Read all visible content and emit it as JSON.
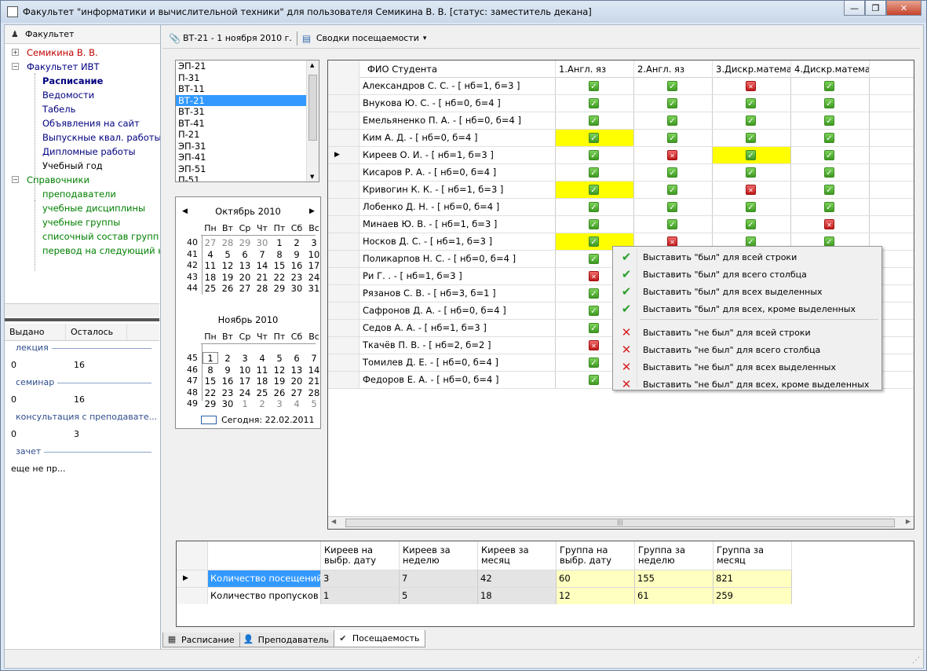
{
  "window": {
    "title": "Факультет \"информатики и вычислительной техники\" для пользователя Семикина В. В. [статус: заместитель декана]",
    "min": "—",
    "max": "❐",
    "close": "✕"
  },
  "left_panel": {
    "header": "Факультет",
    "tree": [
      {
        "label": "Семикина В. В.",
        "level": 0,
        "color": "red",
        "expander": "+"
      },
      {
        "label": "Факультет ИВТ",
        "level": 0,
        "color": "navy",
        "expander": "−"
      },
      {
        "label": "Расписание",
        "level": 1,
        "color": "navy",
        "bold": true
      },
      {
        "label": "Ведомости",
        "level": 1,
        "color": "navy"
      },
      {
        "label": "Табель",
        "level": 1,
        "color": "navy"
      },
      {
        "label": "Объявления на сайт",
        "level": 1,
        "color": "navy"
      },
      {
        "label": "Выпускные квал. работы",
        "level": 1,
        "color": "navy"
      },
      {
        "label": "Дипломные работы",
        "level": 1,
        "color": "navy"
      },
      {
        "label": "Учебный год",
        "level": 1,
        "color": "black"
      },
      {
        "label": "Справочники",
        "level": 0,
        "color": "green",
        "expander": "−"
      },
      {
        "label": "преподаватели",
        "level": 1,
        "color": "green"
      },
      {
        "label": "учебные дисциплины",
        "level": 1,
        "color": "green"
      },
      {
        "label": "учебные группы",
        "level": 1,
        "color": "green"
      },
      {
        "label": "списочный состав групп",
        "level": 1,
        "color": "green"
      },
      {
        "label": "перевод на следующий к",
        "level": 1,
        "color": "green"
      }
    ],
    "stats_header": [
      "Выдано",
      "Осталось"
    ],
    "stats": [
      {
        "group": "лекция",
        "issued": "0",
        "left": "16"
      },
      {
        "group": "семинар",
        "issued": "0",
        "left": "16"
      },
      {
        "group": "консультация с преподавате...",
        "issued": "0",
        "left": "3"
      },
      {
        "group": "зачет",
        "issued": "еще не пр...",
        "left": ""
      }
    ]
  },
  "toolbar": {
    "group_date": "ВТ-21 - 1 ноября 2010 г.",
    "reports": "Сводки посещаемости",
    "reports_arrow": "▾"
  },
  "groups_list": {
    "items": [
      "ЭП-21",
      "П-31",
      "ВТ-11",
      "ВТ-21",
      "ВТ-31",
      "ВТ-41",
      "П-21",
      "ЭП-31",
      "ЭП-41",
      "ЭП-51",
      "П-51"
    ],
    "selected": "ВТ-21"
  },
  "calendar": {
    "prev": "◀",
    "next": "▶",
    "weekdays": [
      "Пн",
      "Вт",
      "Ср",
      "Чт",
      "Пт",
      "Сб",
      "Вс"
    ],
    "months": [
      {
        "title": "Октябрь 2010",
        "weeks": [
          {
            "n": "40",
            "days": [
              "27",
              "28",
              "29",
              "30",
              "1",
              "2",
              "3"
            ],
            "gray_count": 4
          },
          {
            "n": "41",
            "days": [
              "4",
              "5",
              "6",
              "7",
              "8",
              "9",
              "10"
            ]
          },
          {
            "n": "42",
            "days": [
              "11",
              "12",
              "13",
              "14",
              "15",
              "16",
              "17"
            ]
          },
          {
            "n": "43",
            "days": [
              "18",
              "19",
              "20",
              "21",
              "22",
              "23",
              "24"
            ]
          },
          {
            "n": "44",
            "days": [
              "25",
              "26",
              "27",
              "28",
              "29",
              "30",
              "31"
            ]
          }
        ]
      },
      {
        "title": "Ноябрь 2010",
        "weeks": [
          {
            "n": "45",
            "days": [
              "1",
              "2",
              "3",
              "4",
              "5",
              "6",
              "7"
            ],
            "selected_index": 0
          },
          {
            "n": "46",
            "days": [
              "8",
              "9",
              "10",
              "11",
              "12",
              "13",
              "14"
            ]
          },
          {
            "n": "47",
            "days": [
              "15",
              "16",
              "17",
              "18",
              "19",
              "20",
              "21"
            ]
          },
          {
            "n": "48",
            "days": [
              "22",
              "23",
              "24",
              "25",
              "26",
              "27",
              "28"
            ]
          },
          {
            "n": "49",
            "days": [
              "29",
              "30",
              "1",
              "2",
              "3",
              "4",
              "5"
            ],
            "gray_from": 2
          }
        ]
      }
    ],
    "today": "Сегодня: 22.02.2011"
  },
  "attendance": {
    "columns": [
      "ФИО Студента",
      "1.Англ. яз",
      "2.Англ. яз",
      "3.Дискр.матема",
      "4.Дискр.матема"
    ],
    "current_row": 4,
    "rows": [
      {
        "name": "Александров С. С. - [ нб=1, б=3 ]",
        "marks": [
          "g",
          "g",
          "r",
          "g"
        ],
        "yellow": []
      },
      {
        "name": "Внукова Ю. С. - [ нб=0, б=4 ]",
        "marks": [
          "g",
          "g",
          "g",
          "g"
        ],
        "yellow": []
      },
      {
        "name": "Емельяненко П. А. - [ нб=0, б=4 ]",
        "marks": [
          "g",
          "g",
          "g",
          "g"
        ],
        "yellow": []
      },
      {
        "name": "Ким А. Д. - [ нб=0, б=4 ]",
        "marks": [
          "g",
          "g",
          "g",
          "g"
        ],
        "yellow": [
          0
        ]
      },
      {
        "name": "Киреев О. И. - [ нб=1, б=3 ]",
        "marks": [
          "g",
          "r",
          "g",
          "g"
        ],
        "yellow": [
          2
        ]
      },
      {
        "name": "Кисаров Р. А. - [ нб=0, б=4 ]",
        "marks": [
          "g",
          "g",
          "g",
          "g"
        ],
        "yellow": []
      },
      {
        "name": "Кривогин К. К. - [ нб=1, б=3 ]",
        "marks": [
          "g",
          "g",
          "r",
          "g"
        ],
        "yellow": [
          0
        ]
      },
      {
        "name": "Лобенко Д. Н. - [ нб=0, б=4 ]",
        "marks": [
          "g",
          "g",
          "g",
          "g"
        ],
        "yellow": []
      },
      {
        "name": "Минаев Ю. В. - [ нб=1, б=3 ]",
        "marks": [
          "g",
          "g",
          "g",
          "r"
        ],
        "yellow": []
      },
      {
        "name": "Носков Д. С. - [ нб=1, б=3 ]",
        "marks": [
          "g",
          "r",
          "g",
          "g"
        ],
        "yellow": [
          0
        ]
      },
      {
        "name": "Поликарпов Н. С. - [ нб=0, б=4 ]",
        "marks": [
          "g",
          "",
          "",
          ""
        ],
        "yellow": []
      },
      {
        "name": "Ри Г. . - [ нб=1, б=3 ]",
        "marks": [
          "r",
          "",
          "",
          ""
        ],
        "yellow": []
      },
      {
        "name": "Рязанов С. В. - [ нб=3, б=1 ]",
        "marks": [
          "g",
          "",
          "",
          ""
        ],
        "yellow": []
      },
      {
        "name": "Сафронов Д. А. - [ нб=0, б=4 ]",
        "marks": [
          "g",
          "",
          "",
          ""
        ],
        "yellow": []
      },
      {
        "name": "Седов А. А. - [ нб=1, б=3 ]",
        "marks": [
          "g",
          "",
          "",
          ""
        ],
        "yellow": []
      },
      {
        "name": "Ткачёв П. В. - [ нб=2, б=2 ]",
        "marks": [
          "r",
          "",
          "",
          ""
        ],
        "yellow": []
      },
      {
        "name": "Томилев Д. Е. - [ нб=0, б=4 ]",
        "marks": [
          "g",
          "",
          "",
          ""
        ],
        "yellow": []
      },
      {
        "name": "Федоров Е. А. - [ нб=0, б=4 ]",
        "marks": [
          "g",
          "",
          "",
          ""
        ],
        "yellow": []
      }
    ]
  },
  "context_menu": {
    "items": [
      {
        "icon": "check",
        "label": "Выставить \"был\" для всей строки"
      },
      {
        "icon": "check",
        "label": "Выставить \"был\" для всего столбца"
      },
      {
        "icon": "check",
        "label": "Выставить \"был\" для всех выделенных"
      },
      {
        "icon": "check",
        "label": "Выставить \"был\" для всех, кроме выделенных"
      },
      {
        "icon": "cross",
        "label": "Выставить \"не был\" для всей строки"
      },
      {
        "icon": "cross",
        "label": "Выставить \"не был\" для всего столбца"
      },
      {
        "icon": "cross",
        "label": "Выставить \"не был\" для всех выделенных"
      },
      {
        "icon": "cross",
        "label": "Выставить \"не был\" для всех, кроме выделенных"
      }
    ]
  },
  "summary": {
    "columns": [
      "Киреев на\nвыбр. дату",
      "Киреев за\nнеделю",
      "Киреев за\nмесяц",
      "Группа на\nвыбр. дату",
      "Группа за\nнеделю",
      "Группа за\nмесяц"
    ],
    "rows": [
      {
        "label": "Количество посещений",
        "values": [
          "3",
          "7",
          "42",
          "60",
          "155",
          "821"
        ]
      },
      {
        "label": "Количество пропусков",
        "values": [
          "1",
          "5",
          "18",
          "12",
          "61",
          "259"
        ]
      }
    ]
  },
  "tabs": [
    {
      "label": "Расписание",
      "icon": "calendar-grid-icon"
    },
    {
      "label": "Преподаватель",
      "icon": "teacher-icon"
    },
    {
      "label": "Посещаемость",
      "icon": "attendance-icon",
      "active": true
    }
  ],
  "colors": {
    "selection": "#3399ff",
    "highlight": "#ffff00",
    "summary_group": "#ffffc0"
  }
}
